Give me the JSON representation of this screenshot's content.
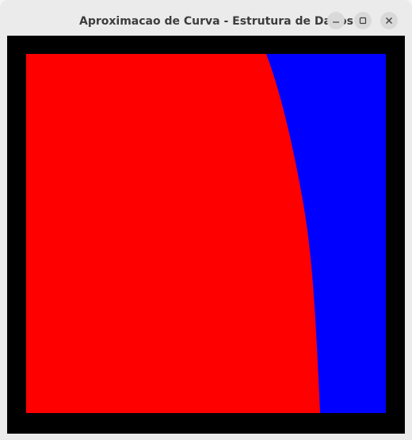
{
  "window": {
    "title": "Aproximacao de Curva - Estrutura de Dados",
    "controls": {
      "minimize_icon": "minimize-icon",
      "maximize_icon": "maximize-icon",
      "close_icon": "close-icon"
    }
  },
  "colors": {
    "background": "#000000",
    "region_left": "#ff0000",
    "region_right": "#0000ff"
  }
}
